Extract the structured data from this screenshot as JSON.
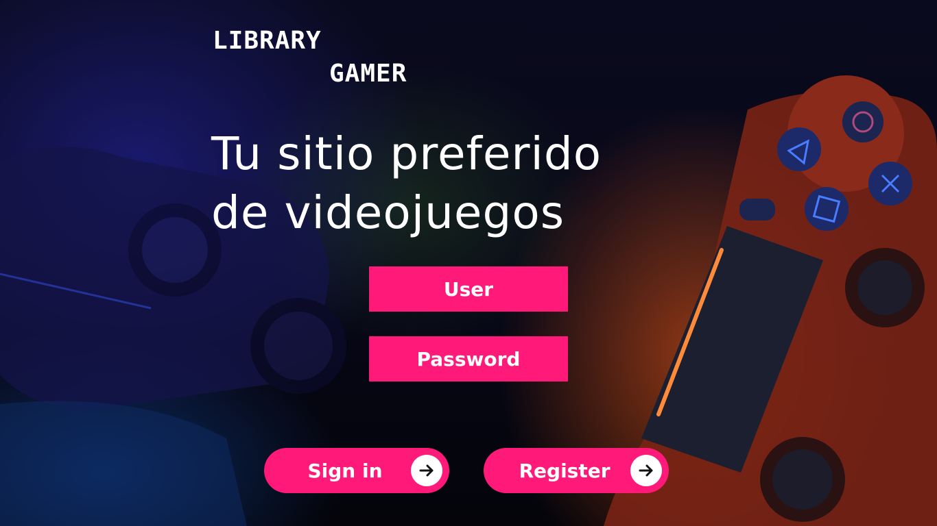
{
  "logo": {
    "line1": "LIBRARY",
    "line2": "GAMER"
  },
  "headline": {
    "line1": "Tu sitio preferido",
    "line2": "de videojuegos"
  },
  "form": {
    "user_placeholder": "User",
    "password_placeholder": "Password"
  },
  "actions": {
    "signin_label": "Sign in",
    "register_label": "Register"
  },
  "icons": {
    "signin_arrow": "arrow-right-icon",
    "register_arrow": "arrow-right-icon"
  },
  "colors": {
    "accent": "#ff1a7a",
    "text": "#ffffff",
    "background": "#07071a"
  }
}
